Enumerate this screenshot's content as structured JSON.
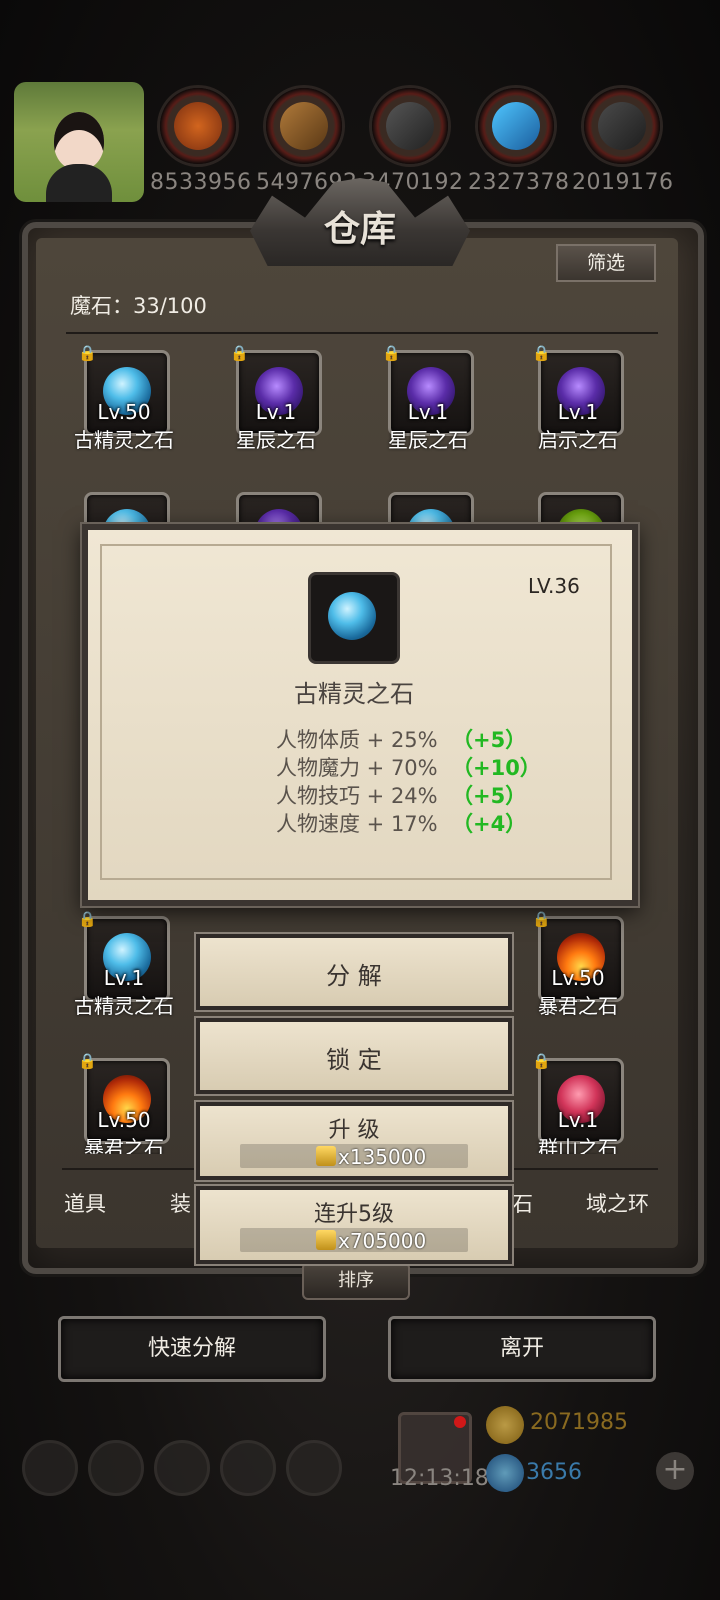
{
  "resources": {
    "values": [
      "8533956",
      "5497692",
      "3470192",
      "2327378",
      "2019176"
    ],
    "icons": [
      "meat-icon",
      "wood-icon",
      "iron-icon",
      "crystal-icon",
      "stone-icon"
    ]
  },
  "panel": {
    "title": "仓库",
    "filter_label": "筛选",
    "stone_count": "魔石：33/100"
  },
  "grid": {
    "row1": [
      {
        "level": "Lv.50",
        "name": "古精灵之石"
      },
      {
        "level": "Lv.1",
        "name": "星辰之石"
      },
      {
        "level": "Lv.1",
        "name": "星辰之石"
      },
      {
        "level": "Lv.1",
        "name": "启示之石"
      }
    ],
    "row4": [
      {
        "level": "Lv.1",
        "name": "古精灵之石"
      },
      {
        "level": "Lv.50",
        "name": "暴君之石"
      }
    ],
    "row5": [
      {
        "level": "Lv.50",
        "name": "暴君之石"
      },
      {
        "level": "Lv.1",
        "name": "群山之石"
      }
    ]
  },
  "tabs": [
    "道具",
    "装",
    "石",
    "域之环"
  ],
  "sort_label": "排序",
  "buttons": {
    "quick_decompose": "快速分解",
    "leave": "离开"
  },
  "hud": {
    "timer": "12:13:18",
    "gold": "2071985",
    "gems": "3656",
    "plus": "+"
  },
  "detail": {
    "level": "LV.36",
    "name": "古精灵之石",
    "stats": [
      {
        "text": "人物体质 + 25%",
        "bonus": "（+5）"
      },
      {
        "text": "人物魔力 + 70%",
        "bonus": "（+10）"
      },
      {
        "text": "人物技巧 + 24%",
        "bonus": "（+5）"
      },
      {
        "text": "人物速度 + 17%",
        "bonus": "（+4）"
      }
    ]
  },
  "actions": {
    "decompose": "分 解",
    "lock": "锁 定",
    "upgrade": "升 级",
    "upgrade_cost": "x135000",
    "upgrade5": "连升5级",
    "upgrade5_cost": "x705000"
  }
}
